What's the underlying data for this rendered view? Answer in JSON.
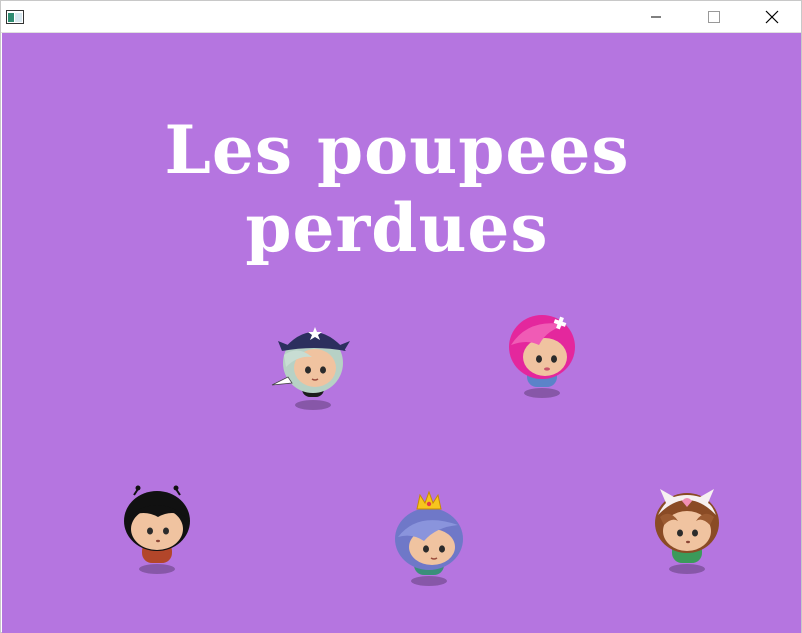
{
  "window": {
    "icon": "app-window-icon",
    "controls": [
      "minimize-icon",
      "maximize-icon",
      "close-icon"
    ]
  },
  "game": {
    "title": "Les poupees perdues",
    "background_color": "#b575e0",
    "dolls": [
      {
        "id": "sailor",
        "hair": "#b7d1c5",
        "hat": "#2c2f5e",
        "accessory": "star-hat"
      },
      {
        "id": "pink-hair",
        "hair": "#e4279d",
        "accessory": "cross-clip"
      },
      {
        "id": "black-hair",
        "hair": "#111111",
        "accessory": "antennae"
      },
      {
        "id": "princess",
        "hair": "#6f78c8",
        "accessory": "crown"
      },
      {
        "id": "cat-hat",
        "hair": "#8a4b25",
        "hat": "#f6f1f1",
        "accessory": "cat-ears"
      }
    ]
  }
}
